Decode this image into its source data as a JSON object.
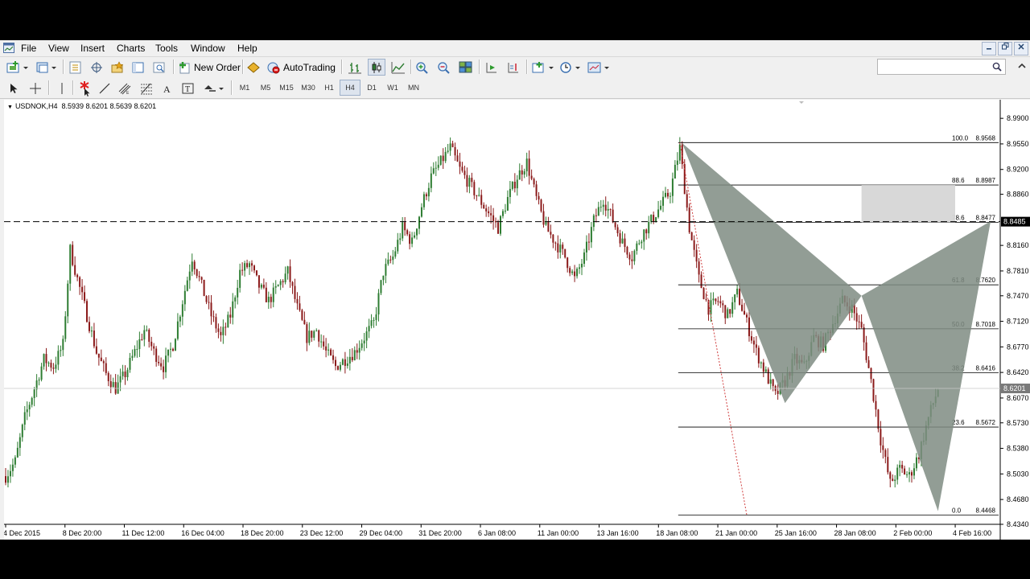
{
  "menu": [
    "File",
    "View",
    "Insert",
    "Charts",
    "Tools",
    "Window",
    "Help"
  ],
  "toolbar": {
    "new_order_label": "New Order",
    "autotrading_label": "AutoTrading",
    "timeframes": [
      "M1",
      "M5",
      "M15",
      "M30",
      "H1",
      "H4",
      "D1",
      "W1",
      "MN"
    ],
    "active_timeframe": "H4",
    "search_placeholder": ""
  },
  "chart_title": {
    "symbol_tf": "USDNOK,H4",
    "ohlc": "8.5939 8.6201 8.5639 8.6201"
  },
  "colors": {
    "bull": "#2e7d32",
    "bear": "#8b1a1a",
    "pattern": "#7f8c83",
    "prz": "#d6d6d6"
  },
  "chart_data": {
    "type": "candlestick",
    "symbol": "USDNOK",
    "timeframe": "H4",
    "ylim": [
      8.434,
      9.01
    ],
    "y_ticks": [
      "8.9900",
      "8.9550",
      "8.9200",
      "8.8860",
      "8.8160",
      "8.7810",
      "8.7470",
      "8.7120",
      "8.6770",
      "8.6420",
      "8.6070",
      "8.5730",
      "8.5380",
      "8.5030",
      "8.4680",
      "8.4340"
    ],
    "x_ticks": [
      "4 Dec 2015",
      "8 Dec 20:00",
      "11 Dec 12:00",
      "16 Dec 04:00",
      "18 Dec 20:00",
      "23 Dec 12:00",
      "29 Dec 04:00",
      "31 Dec 20:00",
      "6 Jan 08:00",
      "11 Jan 00:00",
      "13 Jan 16:00",
      "18 Jan 08:00",
      "21 Jan 00:00",
      "25 Jan 16:00",
      "28 Jan 08:00",
      "2 Feb 00:00",
      "4 Feb 16:00"
    ],
    "bid_price": 8.6201,
    "alert_line": 8.8485,
    "alert_label": "8.8485",
    "bid_label": "8.6201",
    "fibonacci": [
      {
        "level": "100.0",
        "price": "8.9568"
      },
      {
        "level": "88.6",
        "price": "8.8987"
      },
      {
        "level": "78.6",
        "price": "8.8477"
      },
      {
        "level": "61.8",
        "price": "8.7620"
      },
      {
        "level": "50.0",
        "price": "8.7018"
      },
      {
        "level": "38.2",
        "price": "8.6416"
      },
      {
        "level": "23.6",
        "price": "8.5672"
      },
      {
        "level": "0.0",
        "price": "8.4468"
      }
    ],
    "harmonic_pattern": {
      "X": [
        "21 Jan 00:00",
        8.956
      ],
      "A": [
        "28 Jan 08:00",
        8.6
      ],
      "B": [
        "2 Feb 00:00",
        8.747
      ],
      "C": [
        "4 Feb 16:00",
        8.452
      ],
      "D": [
        "4 Feb 16:00+",
        8.849
      ]
    },
    "path": [
      [
        0,
        8.5
      ],
      [
        4,
        8.52
      ],
      [
        8,
        8.58
      ],
      [
        12,
        8.62
      ],
      [
        16,
        8.66
      ],
      [
        20,
        8.65
      ],
      [
        24,
        8.68
      ],
      [
        27,
        8.81
      ],
      [
        30,
        8.77
      ],
      [
        34,
        8.72
      ],
      [
        38,
        8.67
      ],
      [
        42,
        8.64
      ],
      [
        46,
        8.62
      ],
      [
        50,
        8.64
      ],
      [
        54,
        8.67
      ],
      [
        58,
        8.7
      ],
      [
        62,
        8.67
      ],
      [
        66,
        8.65
      ],
      [
        70,
        8.68
      ],
      [
        74,
        8.74
      ],
      [
        78,
        8.8
      ],
      [
        82,
        8.76
      ],
      [
        86,
        8.72
      ],
      [
        90,
        8.69
      ],
      [
        94,
        8.72
      ],
      [
        98,
        8.78
      ],
      [
        102,
        8.79
      ],
      [
        106,
        8.76
      ],
      [
        110,
        8.74
      ],
      [
        114,
        8.76
      ],
      [
        118,
        8.78
      ],
      [
        122,
        8.73
      ],
      [
        126,
        8.69
      ],
      [
        130,
        8.7
      ],
      [
        134,
        8.67
      ],
      [
        138,
        8.65
      ],
      [
        142,
        8.66
      ],
      [
        146,
        8.67
      ],
      [
        150,
        8.69
      ],
      [
        154,
        8.71
      ],
      [
        158,
        8.78
      ],
      [
        162,
        8.8
      ],
      [
        166,
        8.84
      ],
      [
        170,
        8.82
      ],
      [
        174,
        8.87
      ],
      [
        178,
        8.91
      ],
      [
        182,
        8.93
      ],
      [
        186,
        8.95
      ],
      [
        190,
        8.92
      ],
      [
        194,
        8.9
      ],
      [
        198,
        8.88
      ],
      [
        202,
        8.86
      ],
      [
        206,
        8.84
      ],
      [
        210,
        8.88
      ],
      [
        214,
        8.91
      ],
      [
        218,
        8.93
      ],
      [
        222,
        8.88
      ],
      [
        226,
        8.84
      ],
      [
        230,
        8.82
      ],
      [
        234,
        8.8
      ],
      [
        238,
        8.77
      ],
      [
        242,
        8.8
      ],
      [
        246,
        8.85
      ],
      [
        250,
        8.88
      ],
      [
        254,
        8.85
      ],
      [
        258,
        8.82
      ],
      [
        262,
        8.8
      ],
      [
        266,
        8.83
      ],
      [
        270,
        8.85
      ],
      [
        274,
        8.87
      ],
      [
        278,
        8.89
      ],
      [
        282,
        8.95
      ],
      [
        286,
        8.84
      ],
      [
        290,
        8.77
      ],
      [
        294,
        8.73
      ],
      [
        298,
        8.74
      ],
      [
        302,
        8.72
      ],
      [
        306,
        8.75
      ],
      [
        310,
        8.71
      ],
      [
        314,
        8.67
      ],
      [
        318,
        8.64
      ],
      [
        322,
        8.61
      ],
      [
        326,
        8.63
      ],
      [
        330,
        8.66
      ],
      [
        334,
        8.65
      ],
      [
        338,
        8.69
      ],
      [
        342,
        8.68
      ],
      [
        346,
        8.71
      ],
      [
        350,
        8.74
      ],
      [
        354,
        8.73
      ],
      [
        358,
        8.7
      ],
      [
        362,
        8.63
      ],
      [
        366,
        8.55
      ],
      [
        370,
        8.49
      ],
      [
        374,
        8.51
      ],
      [
        378,
        8.5
      ],
      [
        382,
        8.53
      ],
      [
        386,
        8.58
      ],
      [
        390,
        8.62
      ]
    ]
  }
}
